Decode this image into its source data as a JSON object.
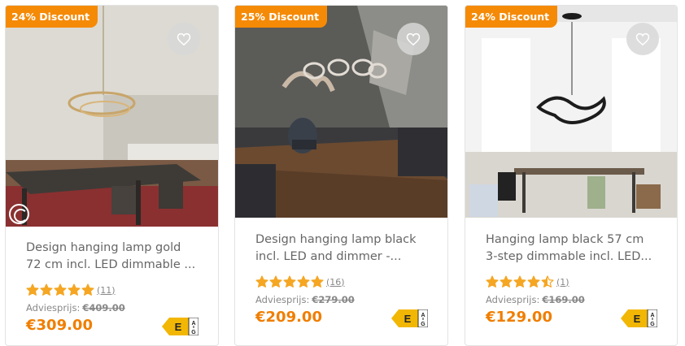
{
  "products": [
    {
      "badge": "24% Discount",
      "title_line1": "Design hanging lamp gold",
      "title_line2": "72 cm incl. LED dimmable ...",
      "stars": 5,
      "review_count": "(11)",
      "advies_label": "Adviesprijs:",
      "old_price": "€409.00",
      "price": "€309.00",
      "energy_class": "E",
      "energy_top": "A",
      "energy_bottom": "G"
    },
    {
      "badge": "25% Discount",
      "title_line1": "Design hanging lamp black",
      "title_line2": "incl. LED and dimmer -...",
      "stars": 5,
      "review_count": "(16)",
      "advies_label": "Adviesprijs:",
      "old_price": "€279.00",
      "price": "€209.00",
      "energy_class": "E",
      "energy_top": "A",
      "energy_bottom": "G"
    },
    {
      "badge": "24% Discount",
      "title_line1": "Hanging lamp black 57 cm",
      "title_line2": "3-step dimmable incl. LED...",
      "stars": 4.5,
      "review_count": "(1)",
      "advies_label": "Adviesprijs:",
      "old_price": "€169.00",
      "price": "€129.00",
      "energy_class": "E",
      "energy_top": "A",
      "energy_bottom": "G"
    }
  ],
  "colors": {
    "badge": "#f58a07",
    "price": "#f07e00",
    "star": "#f5a623",
    "energy": "#f2b705"
  },
  "icons": {
    "favorite": "heart-outline-icon",
    "rating": "star-icon",
    "video": "video-play-icon"
  }
}
